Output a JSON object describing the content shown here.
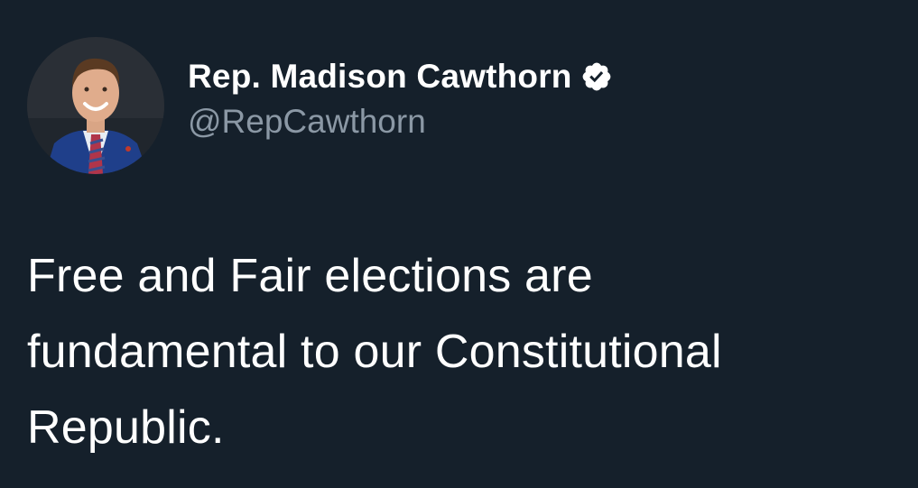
{
  "author": {
    "display_name": "Rep. Madison Cawthorn",
    "handle": "@RepCawthorn",
    "verified_icon": "verified-badge-icon",
    "avatar": "profile-photo"
  },
  "tweet": {
    "lines": [
      "Free and Fair elections are",
      "fundamental to our Constitutional",
      "Republic."
    ]
  },
  "colors": {
    "background": "#15202b",
    "text": "#ffffff",
    "handle": "#8b98a5"
  }
}
